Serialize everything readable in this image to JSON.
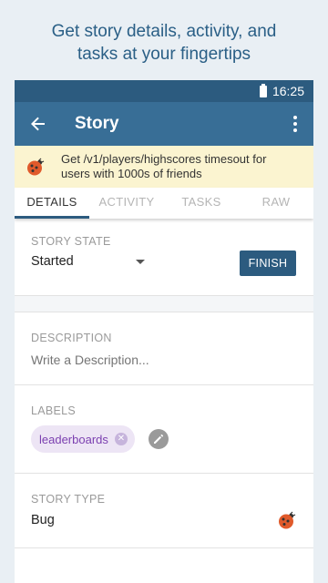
{
  "promo": {
    "line1": "Get story details, activity, and",
    "line2": "tasks at your fingertips"
  },
  "status_bar": {
    "time": "16:25"
  },
  "app_bar": {
    "title": "Story"
  },
  "banner": {
    "story_name": "Get /v1/players/highscores timesout for users with 1000s of friends"
  },
  "tabs": [
    {
      "label": "DETAILS",
      "active": true
    },
    {
      "label": "ACTIVITY",
      "active": false
    },
    {
      "label": "TASKS",
      "active": false
    },
    {
      "label": "RAW",
      "active": false
    }
  ],
  "story_state": {
    "label": "STORY STATE",
    "value": "Started",
    "action": "FINISH"
  },
  "description": {
    "label": "DESCRIPTION",
    "placeholder": "Write a Description..."
  },
  "labels": {
    "label": "LABELS",
    "chips": [
      "leaderboards"
    ]
  },
  "story_type": {
    "label": "STORY TYPE",
    "value": "Bug"
  },
  "colors": {
    "status_bar": "#2c5b7f",
    "app_bar": "#386e96",
    "banner_bg": "#fbf4d0",
    "finish_button": "#2c5b7f",
    "chip_bg": "#ede5f5",
    "chip_text": "#7b3fb0",
    "bug_icon": "#e05a2b"
  }
}
